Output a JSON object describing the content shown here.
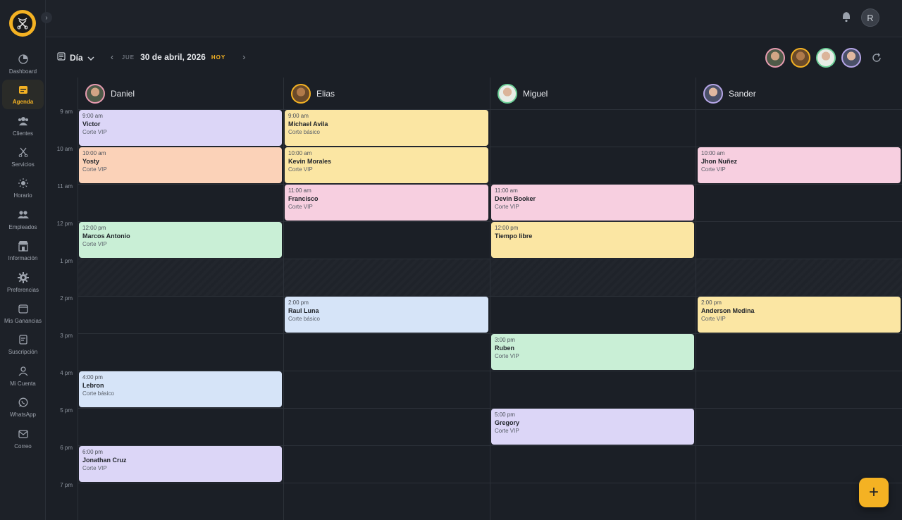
{
  "sidebar": {
    "items": [
      {
        "label": "Dashboard",
        "icon": "dashboard-icon"
      },
      {
        "label": "Agenda",
        "icon": "calendar-icon"
      },
      {
        "label": "Clientes",
        "icon": "clients-icon"
      },
      {
        "label": "Servicios",
        "icon": "scissors-icon"
      },
      {
        "label": "Horario",
        "icon": "sun-icon"
      },
      {
        "label": "Empleados",
        "icon": "employees-icon"
      },
      {
        "label": "Información",
        "icon": "store-icon"
      },
      {
        "label": "Preferencias",
        "icon": "gear-icon"
      },
      {
        "label": "Mis Ganancias",
        "icon": "wallet-icon"
      },
      {
        "label": "Suscripción",
        "icon": "receipt-icon"
      },
      {
        "label": "Mi Cuenta",
        "icon": "user-icon"
      },
      {
        "label": "WhatsApp",
        "icon": "whatsapp-icon"
      },
      {
        "label": "Correo",
        "icon": "mail-icon"
      }
    ],
    "active": "Agenda"
  },
  "header": {
    "user_initial": "R"
  },
  "toolbar": {
    "view_label": "Día",
    "day_of_week": "JUE",
    "date": "30 de abril, 2026",
    "today_label": "HOY"
  },
  "times": [
    "9 am",
    "10 am",
    "11 am",
    "12 pm",
    "1 pm",
    "2 pm",
    "3 pm",
    "4 pm",
    "5 pm",
    "6 pm",
    "7 pm"
  ],
  "staff": [
    {
      "name": "Daniel",
      "ring": "#e79bb0"
    },
    {
      "name": "Elias",
      "ring": "#f4b223"
    },
    {
      "name": "Miguel",
      "ring": "#6ccf97"
    },
    {
      "name": "Sander",
      "ring": "#b6a6e8"
    }
  ],
  "appointments": {
    "daniel": [
      {
        "time": "9:00 am",
        "name": "Victor",
        "service": "Corte VIP",
        "color": "#dcd6f7"
      },
      {
        "time": "10:00 am",
        "name": "Yosty",
        "service": "Corte VIP",
        "color": "#fbd2b8"
      },
      {
        "time": "12:00 pm",
        "name": "Marcos Antonio",
        "service": "Corte VIP",
        "color": "#c9efd6"
      },
      {
        "time": "4:00 pm",
        "name": "Lebron",
        "service": "Corte básico",
        "color": "#d6e4f8"
      },
      {
        "time": "6:00 pm",
        "name": "Jonathan Cruz",
        "service": "Corte VIP",
        "color": "#dcd6f7"
      }
    ],
    "elias": [
      {
        "time": "9:00 am",
        "name": "Michael Avila",
        "service": "Corte básico",
        "color": "#fbe6a3"
      },
      {
        "time": "10:00 am",
        "name": "Kevin Morales",
        "service": "Corte VIP",
        "color": "#fbe6a3"
      },
      {
        "time": "11:00 am",
        "name": "Francisco",
        "service": "Corte VIP",
        "color": "#f7cfe0"
      },
      {
        "time": "2:00 pm",
        "name": "Raul Luna",
        "service": "Corte básico",
        "color": "#d6e4f8"
      }
    ],
    "miguel": [
      {
        "time": "11:00 am",
        "name": "Devin Booker",
        "service": "Corte VIP",
        "color": "#f7cfe0"
      },
      {
        "time": "12:00 pm",
        "name": "Tiempo libre",
        "service": "",
        "color": "#fbe6a3"
      },
      {
        "time": "3:00 pm",
        "name": "Ruben",
        "service": "Corte VIP",
        "color": "#c9efd6"
      },
      {
        "time": "5:00 pm",
        "name": "Gregory",
        "service": "Corte VIP",
        "color": "#dcd6f7"
      }
    ],
    "sander": [
      {
        "time": "10:00 am",
        "name": "Jhon Nuñez",
        "service": "Corte VIP",
        "color": "#f7cfe0"
      },
      {
        "time": "2:00 pm",
        "name": "Anderson Medina",
        "service": "Corte VIP",
        "color": "#fbe6a3"
      }
    ]
  },
  "colors": {
    "accent": "#f4b223",
    "background": "#1b1f26"
  }
}
